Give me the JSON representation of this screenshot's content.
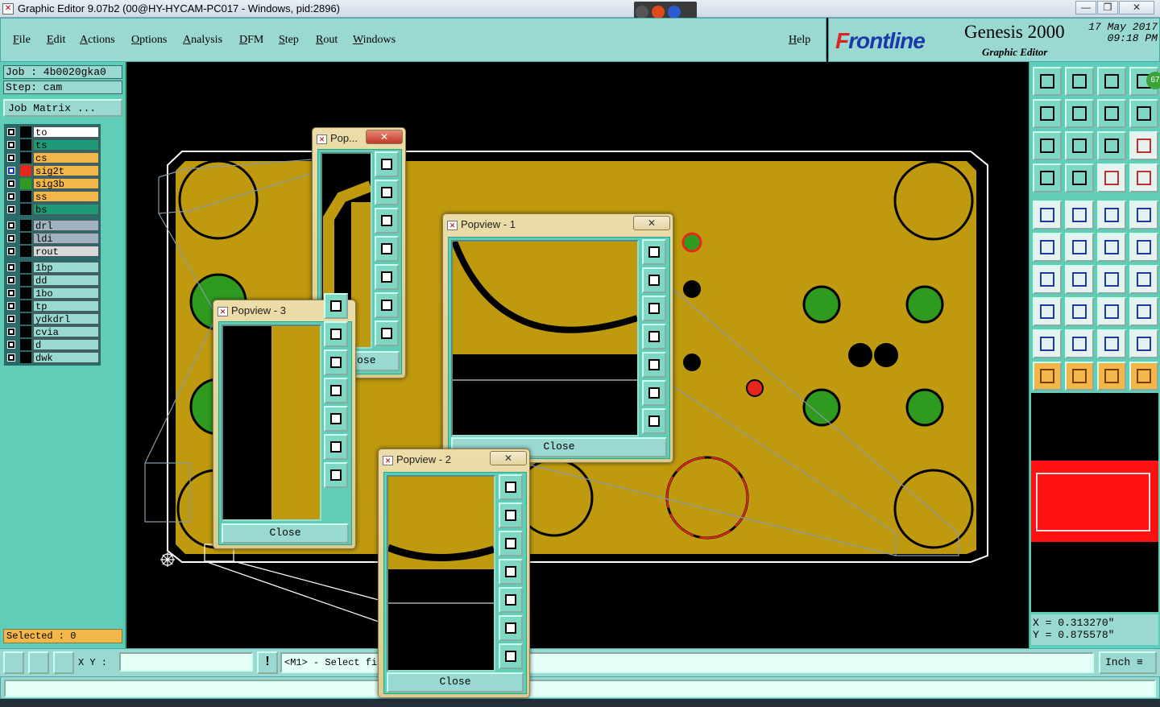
{
  "window": {
    "title": "Graphic Editor 9.07b2 (00@HY-HYCAM-PC017 - Windows, pid:2896)",
    "minimize": "—",
    "maximize": "❐",
    "close": "✕"
  },
  "menu": [
    "File",
    "Edit",
    "Actions",
    "Options",
    "Analysis",
    "DFM",
    "Step",
    "Rout",
    "Windows"
  ],
  "help": "Help",
  "brand": {
    "logo_prefix": "F",
    "logo_rest": "rontline",
    "product": "Genesis 2000",
    "subtitle": "Graphic Editor",
    "date": "17 May 2017",
    "time": "09:18 PM"
  },
  "job": {
    "job_label": "Job : 4b0020gka0",
    "step_label": "Step: cam",
    "job_matrix": "Job Matrix ..."
  },
  "layers": [
    {
      "name": "to",
      "bg": "#ffffff",
      "swatch": "#000000"
    },
    {
      "name": "ts",
      "bg": "#1f9a78",
      "swatch": "#000000"
    },
    {
      "name": "cs",
      "bg": "#f2b748",
      "swatch": "#000000"
    },
    {
      "name": "sig2t",
      "bg": "#f2b748",
      "swatch": "#e8261c",
      "active": true
    },
    {
      "name": "sig3b",
      "bg": "#f2b748",
      "swatch": "#2e9a1f"
    },
    {
      "name": "ss",
      "bg": "#f2b748",
      "swatch": "#000000"
    },
    {
      "name": "bs",
      "bg": "#1f9a78",
      "swatch": "#000000"
    },
    {
      "name": "drl",
      "bg": "#9fb4c0",
      "swatch": "#000000"
    },
    {
      "name": "ldi",
      "bg": "#9fb4c0",
      "swatch": "#000000"
    },
    {
      "name": "rout",
      "bg": "#d9d9d9",
      "swatch": "#000000"
    },
    {
      "name": "1bp",
      "bg": "#9ad8d2",
      "swatch": "#000000"
    },
    {
      "name": "dd",
      "bg": "#9ad8d2",
      "swatch": "#000000"
    },
    {
      "name": "1bo",
      "bg": "#9ad8d2",
      "swatch": "#000000"
    },
    {
      "name": "tp",
      "bg": "#9ad8d2",
      "swatch": "#000000"
    },
    {
      "name": "ydkdrl",
      "bg": "#9ad8d2",
      "swatch": "#000000"
    },
    {
      "name": "cvia",
      "bg": "#9ad8d2",
      "swatch": "#000000"
    },
    {
      "name": "d",
      "bg": "#9ad8d2",
      "swatch": "#000000"
    },
    {
      "name": "dwk",
      "bg": "#9ad8d2",
      "swatch": "#000000"
    }
  ],
  "selected": "Selected : 0",
  "coords": {
    "x": "X = 0.313270\"",
    "y": "Y = 0.875578\""
  },
  "bottom": {
    "xy_label": "X Y :",
    "xy_value": "",
    "message": "<M1> - Select fi",
    "units": "Inch ≡"
  },
  "popviews": [
    {
      "title": "Pop...",
      "close_label": "Close"
    },
    {
      "title": "Popview - 1",
      "close_label": "Close"
    },
    {
      "title": "Popview - 2",
      "close_label": "Close"
    },
    {
      "title": "Popview - 3",
      "close_label": "Close"
    }
  ],
  "badge": "67",
  "colors": {
    "panel": "#5fcdb7",
    "panel_light": "#9ad8d2",
    "board": "#c09a0e",
    "pad_green": "#2e9a1f",
    "pad_red": "#e8261c"
  }
}
